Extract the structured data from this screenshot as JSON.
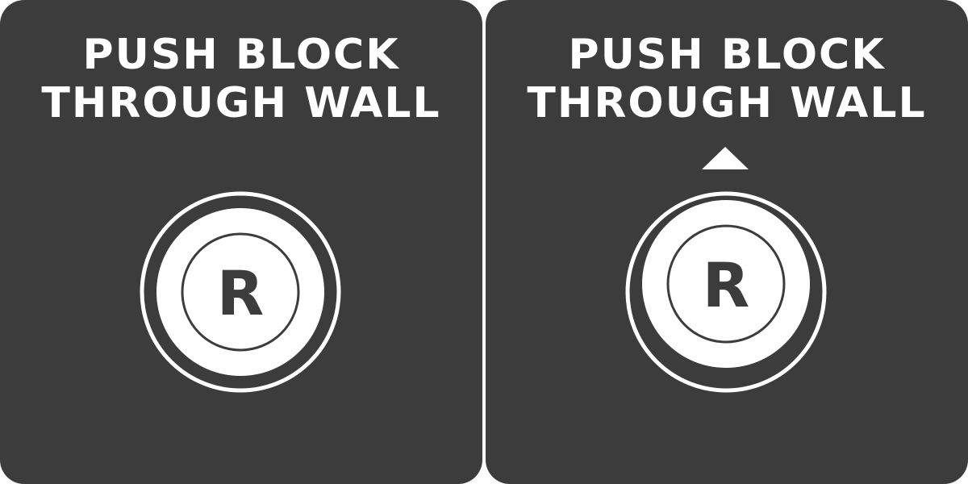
{
  "panels": [
    {
      "title_line1": "PUSH BLOCK",
      "title_line2": "THROUGH WALL",
      "button_letter": "R",
      "button_state": "idle",
      "direction_indicator": null
    },
    {
      "title_line1": "PUSH BLOCK",
      "title_line2": "THROUGH WALL",
      "button_letter": "R",
      "button_state": "pushed-up",
      "direction_indicator": "up-triangle-icon"
    }
  ],
  "colors": {
    "panel_background": "#3c3c3c",
    "foreground": "#ffffff",
    "page_background": "#ffffff"
  }
}
